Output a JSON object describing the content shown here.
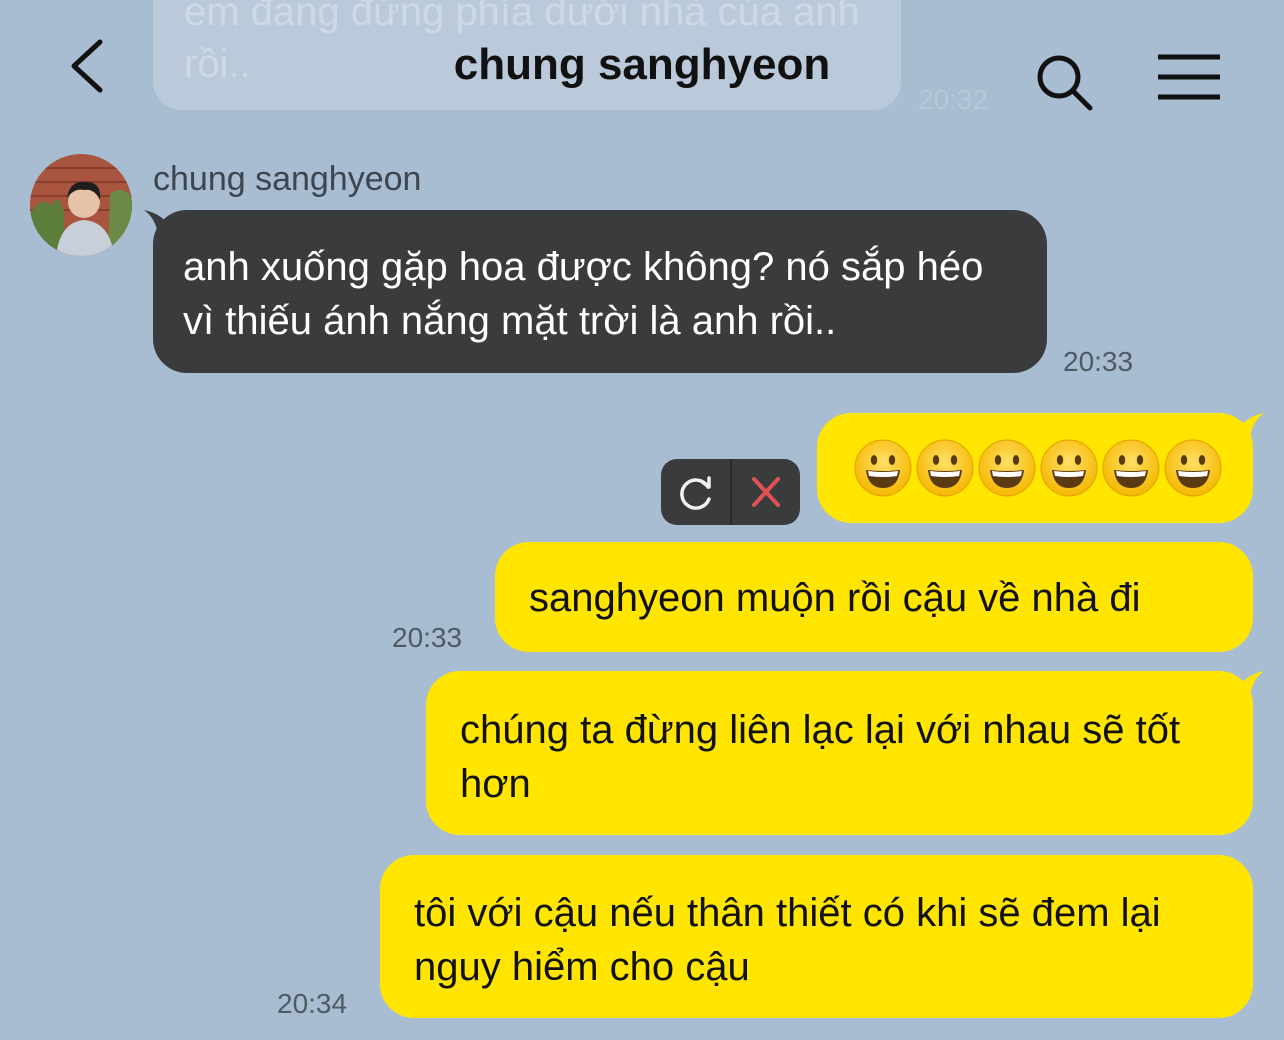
{
  "header": {
    "title": "chung sanghyeon",
    "back_icon": "chevron-left-icon",
    "search_icon": "search-icon",
    "menu_icon": "menu-icon"
  },
  "previous_message": {
    "text": "em đang đứng phía dưới nhà của anh rồi..",
    "time": "20:32"
  },
  "incoming": {
    "sender": "chung sanghyeon",
    "text": "anh xuống gặp hoa được không? nó sắp héo vì thiếu ánh nắng mặt trời là anh rồi..",
    "time": "20:33"
  },
  "failed_message": {
    "emoji": "grinning-face",
    "count": 6,
    "actions": {
      "retry_icon": "refresh-icon",
      "cancel_icon": "close-icon"
    }
  },
  "outgoing": [
    {
      "text": "sanghyeon muộn rồi cậu về nhà đi",
      "time": "20:33"
    },
    {
      "text": "chúng ta đừng liên lạc lại với nhau sẽ tốt hơn",
      "time": ""
    },
    {
      "text": "tôi với cậu nếu thân thiết có khi sẽ đem lại nguy hiểm cho cậu",
      "time": "20:34"
    }
  ],
  "colors": {
    "background": "#a9bdd2",
    "incoming_bubble": "#3a3b3d",
    "outgoing_bubble": "#ffe500"
  }
}
